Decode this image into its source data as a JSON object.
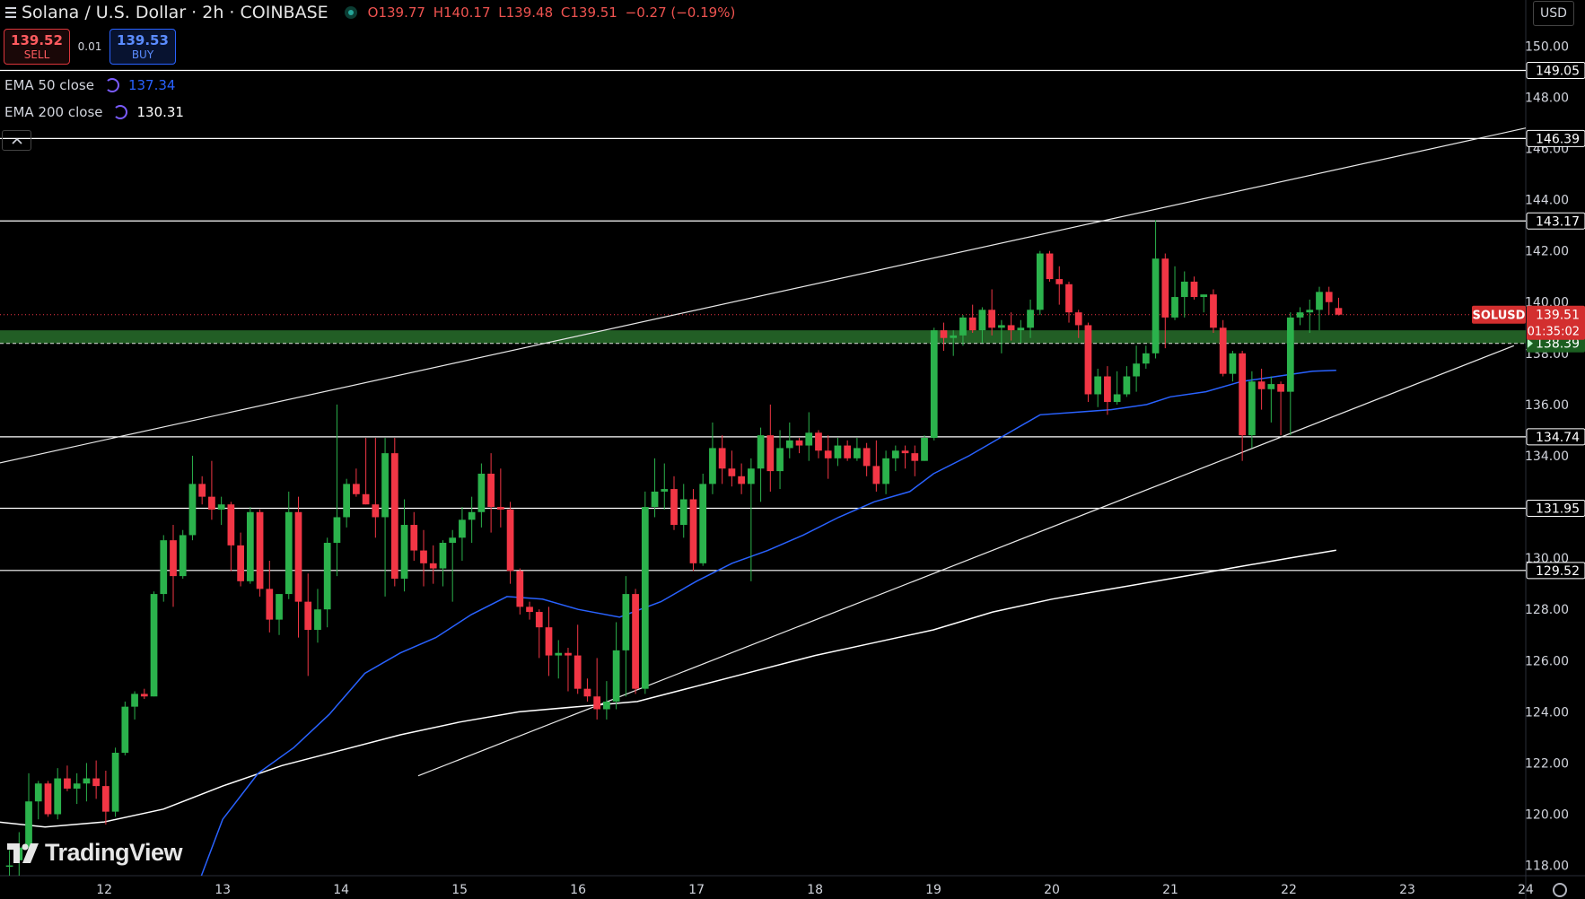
{
  "header": {
    "symbol": "Solana / U.S. Dollar · 2h · COINBASE",
    "open": "O139.77",
    "high": "H140.17",
    "low": "L139.48",
    "close": "C139.51",
    "change": "−0.27 (−0.19%)"
  },
  "trade": {
    "sell_price": "139.52",
    "sell_label": "SELL",
    "spread": "0.01",
    "buy_price": "139.53",
    "buy_label": "BUY"
  },
  "indicators": [
    {
      "label": "EMA 50 close",
      "value": "137.34",
      "color": "#2962ff"
    },
    {
      "label": "EMA 200 close",
      "value": "130.31",
      "color": "#ffffff"
    }
  ],
  "collapse_icon": "chevron-up-icon",
  "currency_button": "USD",
  "brand": "TradingView",
  "chart_data": {
    "type": "candlestick",
    "symbol": "SOLUSD",
    "timeframe": "2h",
    "x_ticks": [
      "12",
      "13",
      "14",
      "15",
      "16",
      "17",
      "18",
      "19",
      "20",
      "21",
      "22",
      "23",
      "24"
    ],
    "y_ticks": [
      "150.00",
      "148.00",
      "146.00",
      "144.00",
      "142.00",
      "140.00",
      "138.00",
      "136.00",
      "134.00",
      "132.00",
      "130.00",
      "128.00",
      "126.00",
      "124.00",
      "122.00",
      "120.00",
      "118.00"
    ],
    "ylim": [
      117.6,
      151.8
    ],
    "xlim": [
      11.12,
      24.0
    ],
    "colors": {
      "up": "#2bb24c",
      "down": "#f23645",
      "ema50": "#2962ff",
      "ema200": "#ffffff",
      "level": "#ffffff",
      "zone": "#2e7d32"
    },
    "horizontal_levels": [
      149.05,
      146.39,
      143.17,
      134.74,
      131.95,
      129.52
    ],
    "support_zone": [
      138.39,
      138.9
    ],
    "last_price": {
      "label": "SOLUSD",
      "value": "139.51",
      "countdown": "01:35:02",
      "price": 139.51
    },
    "zone_label": "138.39",
    "level_labels": [
      "149.05",
      "146.39",
      "143.17",
      "134.74",
      "131.95",
      "129.52"
    ],
    "trendlines": [
      {
        "name": "upper",
        "x": [
          11.0,
          24.0
        ],
        "y": [
          133.6,
          146.8
        ]
      },
      {
        "name": "lower",
        "x": [
          14.65,
          23.9
        ],
        "y": [
          121.5,
          138.3
        ]
      }
    ],
    "ema50": {
      "x": [
        12.82,
        13.0,
        13.3,
        13.6,
        13.9,
        14.2,
        14.5,
        14.8,
        15.1,
        15.4,
        15.7,
        16.0,
        16.35,
        16.7,
        17.0,
        17.3,
        17.6,
        17.9,
        18.2,
        18.5,
        18.8,
        19.0,
        19.3,
        19.6,
        19.9,
        20.2,
        20.5,
        20.8,
        21.0,
        21.3,
        21.6,
        21.9,
        22.2,
        22.4
      ],
      "y": [
        117.6,
        119.8,
        121.6,
        122.6,
        123.9,
        125.5,
        126.3,
        126.9,
        127.8,
        128.5,
        128.4,
        128.0,
        127.7,
        128.3,
        129.1,
        129.8,
        130.3,
        130.9,
        131.6,
        132.2,
        132.6,
        133.3,
        134.0,
        134.8,
        135.6,
        135.7,
        135.8,
        136.0,
        136.3,
        136.5,
        136.9,
        137.1,
        137.3,
        137.34
      ]
    },
    "ema200": {
      "x": [
        11.1,
        11.5,
        12.0,
        12.5,
        13.0,
        13.5,
        14.0,
        14.5,
        15.0,
        15.5,
        16.0,
        16.5,
        17.0,
        17.5,
        18.0,
        18.5,
        19.0,
        19.5,
        20.0,
        20.5,
        21.0,
        21.5,
        22.0,
        22.4
      ],
      "y": [
        119.7,
        119.5,
        119.7,
        120.2,
        121.1,
        121.9,
        122.5,
        123.1,
        123.6,
        124.0,
        124.2,
        124.4,
        125.0,
        125.6,
        126.2,
        126.7,
        127.2,
        127.9,
        128.4,
        128.8,
        129.2,
        129.6,
        130.0,
        130.31
      ]
    },
    "candles": [
      {
        "o": 118.0,
        "h": 118.6,
        "l": 117.6,
        "c": 118.0
      },
      {
        "o": 118.2,
        "h": 119.3,
        "l": 117.6,
        "c": 118.7
      },
      {
        "o": 118.7,
        "h": 121.6,
        "l": 118.3,
        "c": 120.5
      },
      {
        "o": 120.5,
        "h": 121.3,
        "l": 119.8,
        "c": 121.2
      },
      {
        "o": 121.2,
        "h": 121.3,
        "l": 119.9,
        "c": 120.0
      },
      {
        "o": 120.0,
        "h": 121.8,
        "l": 119.8,
        "c": 121.4
      },
      {
        "o": 121.4,
        "h": 121.9,
        "l": 120.9,
        "c": 121.0
      },
      {
        "o": 121.0,
        "h": 121.6,
        "l": 120.4,
        "c": 121.2
      },
      {
        "o": 121.2,
        "h": 122.0,
        "l": 120.5,
        "c": 121.4
      },
      {
        "o": 121.4,
        "h": 122.1,
        "l": 120.6,
        "c": 121.1
      },
      {
        "o": 121.1,
        "h": 121.7,
        "l": 119.6,
        "c": 120.1
      },
      {
        "o": 120.1,
        "h": 122.6,
        "l": 119.9,
        "c": 122.4
      },
      {
        "o": 122.4,
        "h": 124.4,
        "l": 122.3,
        "c": 124.2
      },
      {
        "o": 124.2,
        "h": 124.8,
        "l": 123.7,
        "c": 124.7
      },
      {
        "o": 124.7,
        "h": 124.9,
        "l": 124.5,
        "c": 124.6
      },
      {
        "o": 124.6,
        "h": 128.7,
        "l": 124.6,
        "c": 128.6
      },
      {
        "o": 128.6,
        "h": 130.9,
        "l": 128.3,
        "c": 130.7
      },
      {
        "o": 130.7,
        "h": 131.3,
        "l": 128.1,
        "c": 129.3
      },
      {
        "o": 129.3,
        "h": 131.1,
        "l": 129.2,
        "c": 130.9
      },
      {
        "o": 130.9,
        "h": 134.0,
        "l": 130.7,
        "c": 132.9
      },
      {
        "o": 132.9,
        "h": 133.2,
        "l": 132.1,
        "c": 132.4
      },
      {
        "o": 132.4,
        "h": 133.8,
        "l": 131.5,
        "c": 131.9
      },
      {
        "o": 131.9,
        "h": 132.4,
        "l": 131.3,
        "c": 132.1
      },
      {
        "o": 132.1,
        "h": 132.2,
        "l": 129.5,
        "c": 130.5
      },
      {
        "o": 130.5,
        "h": 131.0,
        "l": 128.9,
        "c": 129.1
      },
      {
        "o": 129.1,
        "h": 132.0,
        "l": 129.0,
        "c": 131.8
      },
      {
        "o": 131.8,
        "h": 131.9,
        "l": 128.5,
        "c": 128.8
      },
      {
        "o": 128.8,
        "h": 129.9,
        "l": 127.1,
        "c": 127.6
      },
      {
        "o": 127.6,
        "h": 128.6,
        "l": 127.0,
        "c": 128.6
      },
      {
        "o": 128.6,
        "h": 132.6,
        "l": 128.4,
        "c": 131.8
      },
      {
        "o": 131.8,
        "h": 132.4,
        "l": 126.9,
        "c": 128.3
      },
      {
        "o": 128.3,
        "h": 129.4,
        "l": 125.4,
        "c": 127.2
      },
      {
        "o": 127.2,
        "h": 128.8,
        "l": 126.7,
        "c": 128.0
      },
      {
        "o": 128.0,
        "h": 130.8,
        "l": 127.3,
        "c": 130.6
      },
      {
        "o": 130.6,
        "h": 136.0,
        "l": 129.3,
        "c": 131.6
      },
      {
        "o": 131.6,
        "h": 133.1,
        "l": 131.2,
        "c": 132.9
      },
      {
        "o": 132.9,
        "h": 133.5,
        "l": 132.4,
        "c": 132.5
      },
      {
        "o": 132.5,
        "h": 134.7,
        "l": 132.1,
        "c": 132.1
      },
      {
        "o": 132.1,
        "h": 134.7,
        "l": 130.8,
        "c": 131.6
      },
      {
        "o": 131.6,
        "h": 134.7,
        "l": 128.5,
        "c": 134.1
      },
      {
        "o": 134.1,
        "h": 134.7,
        "l": 128.9,
        "c": 129.2
      },
      {
        "o": 129.2,
        "h": 132.3,
        "l": 128.7,
        "c": 131.3
      },
      {
        "o": 131.3,
        "h": 131.8,
        "l": 129.9,
        "c": 130.3
      },
      {
        "o": 130.3,
        "h": 131.1,
        "l": 128.9,
        "c": 129.8
      },
      {
        "o": 129.8,
        "h": 130.5,
        "l": 129.0,
        "c": 129.6
      },
      {
        "o": 129.6,
        "h": 130.7,
        "l": 128.9,
        "c": 130.6
      },
      {
        "o": 130.6,
        "h": 131.1,
        "l": 128.3,
        "c": 130.8
      },
      {
        "o": 130.8,
        "h": 132.0,
        "l": 129.9,
        "c": 131.5
      },
      {
        "o": 131.5,
        "h": 132.4,
        "l": 130.6,
        "c": 131.8
      },
      {
        "o": 131.8,
        "h": 133.7,
        "l": 131.2,
        "c": 133.3
      },
      {
        "o": 133.3,
        "h": 134.1,
        "l": 131.0,
        "c": 132.0
      },
      {
        "o": 132.0,
        "h": 133.5,
        "l": 131.2,
        "c": 131.9
      },
      {
        "o": 131.9,
        "h": 132.2,
        "l": 129.0,
        "c": 129.5
      },
      {
        "o": 129.5,
        "h": 129.6,
        "l": 127.8,
        "c": 128.1
      },
      {
        "o": 128.1,
        "h": 128.3,
        "l": 127.6,
        "c": 127.9
      },
      {
        "o": 127.9,
        "h": 128.0,
        "l": 126.1,
        "c": 127.3
      },
      {
        "o": 127.3,
        "h": 128.1,
        "l": 125.4,
        "c": 126.2
      },
      {
        "o": 126.2,
        "h": 126.8,
        "l": 125.3,
        "c": 126.3
      },
      {
        "o": 126.3,
        "h": 126.5,
        "l": 124.8,
        "c": 126.2
      },
      {
        "o": 126.2,
        "h": 127.4,
        "l": 124.7,
        "c": 124.9
      },
      {
        "o": 124.9,
        "h": 125.3,
        "l": 124.4,
        "c": 124.6
      },
      {
        "o": 124.6,
        "h": 126.1,
        "l": 123.7,
        "c": 124.1
      },
      {
        "o": 124.1,
        "h": 125.2,
        "l": 123.7,
        "c": 124.4
      },
      {
        "o": 124.4,
        "h": 127.5,
        "l": 124.1,
        "c": 126.4
      },
      {
        "o": 126.4,
        "h": 129.3,
        "l": 124.6,
        "c": 128.6
      },
      {
        "o": 128.6,
        "h": 128.8,
        "l": 124.7,
        "c": 124.9
      },
      {
        "o": 124.9,
        "h": 132.6,
        "l": 124.7,
        "c": 132.0
      },
      {
        "o": 132.0,
        "h": 133.9,
        "l": 131.6,
        "c": 132.6
      },
      {
        "o": 132.6,
        "h": 133.7,
        "l": 131.9,
        "c": 132.7
      },
      {
        "o": 132.7,
        "h": 133.2,
        "l": 131.1,
        "c": 131.3
      },
      {
        "o": 131.3,
        "h": 132.9,
        "l": 130.8,
        "c": 132.3
      },
      {
        "o": 132.3,
        "h": 132.7,
        "l": 129.5,
        "c": 129.8
      },
      {
        "o": 129.8,
        "h": 133.3,
        "l": 129.7,
        "c": 132.9
      },
      {
        "o": 132.9,
        "h": 135.3,
        "l": 132.5,
        "c": 134.3
      },
      {
        "o": 134.3,
        "h": 134.8,
        "l": 132.9,
        "c": 133.5
      },
      {
        "o": 133.5,
        "h": 134.2,
        "l": 132.8,
        "c": 133.2
      },
      {
        "o": 133.2,
        "h": 133.7,
        "l": 132.5,
        "c": 132.9
      },
      {
        "o": 132.9,
        "h": 133.9,
        "l": 129.1,
        "c": 133.5
      },
      {
        "o": 133.5,
        "h": 135.1,
        "l": 132.2,
        "c": 134.8
      },
      {
        "o": 134.8,
        "h": 136.0,
        "l": 132.6,
        "c": 133.4
      },
      {
        "o": 133.4,
        "h": 135.0,
        "l": 132.7,
        "c": 134.3
      },
      {
        "o": 134.3,
        "h": 135.3,
        "l": 133.9,
        "c": 134.6
      },
      {
        "o": 134.6,
        "h": 134.7,
        "l": 134.1,
        "c": 134.4
      },
      {
        "o": 134.4,
        "h": 135.7,
        "l": 133.8,
        "c": 134.9
      },
      {
        "o": 134.9,
        "h": 135.0,
        "l": 133.9,
        "c": 134.2
      },
      {
        "o": 134.2,
        "h": 134.8,
        "l": 133.1,
        "c": 133.9
      },
      {
        "o": 133.9,
        "h": 134.7,
        "l": 133.6,
        "c": 134.4
      },
      {
        "o": 134.4,
        "h": 134.6,
        "l": 133.8,
        "c": 133.9
      },
      {
        "o": 133.9,
        "h": 134.7,
        "l": 133.8,
        "c": 134.3
      },
      {
        "o": 134.3,
        "h": 134.5,
        "l": 133.2,
        "c": 133.6
      },
      {
        "o": 133.6,
        "h": 134.6,
        "l": 132.6,
        "c": 132.9
      },
      {
        "o": 132.9,
        "h": 134.2,
        "l": 132.5,
        "c": 133.9
      },
      {
        "o": 133.9,
        "h": 134.4,
        "l": 133.4,
        "c": 134.2
      },
      {
        "o": 134.2,
        "h": 134.4,
        "l": 133.5,
        "c": 134.1
      },
      {
        "o": 134.1,
        "h": 134.4,
        "l": 133.2,
        "c": 133.8
      },
      {
        "o": 133.8,
        "h": 134.8,
        "l": 133.8,
        "c": 134.7
      },
      {
        "o": 134.7,
        "h": 139.0,
        "l": 134.6,
        "c": 138.9
      },
      {
        "o": 138.9,
        "h": 139.2,
        "l": 138.1,
        "c": 138.6
      },
      {
        "o": 138.6,
        "h": 138.9,
        "l": 137.9,
        "c": 138.7
      },
      {
        "o": 138.7,
        "h": 139.5,
        "l": 138.3,
        "c": 139.4
      },
      {
        "o": 139.4,
        "h": 139.9,
        "l": 138.8,
        "c": 138.9
      },
      {
        "o": 138.9,
        "h": 139.8,
        "l": 138.4,
        "c": 139.7
      },
      {
        "o": 139.7,
        "h": 140.5,
        "l": 138.7,
        "c": 139.0
      },
      {
        "o": 139.0,
        "h": 139.3,
        "l": 138.0,
        "c": 139.1
      },
      {
        "o": 139.1,
        "h": 139.6,
        "l": 138.5,
        "c": 138.9
      },
      {
        "o": 138.9,
        "h": 139.3,
        "l": 138.4,
        "c": 139.0
      },
      {
        "o": 139.0,
        "h": 140.1,
        "l": 138.6,
        "c": 139.7
      },
      {
        "o": 139.7,
        "h": 142.0,
        "l": 139.5,
        "c": 141.9
      },
      {
        "o": 141.9,
        "h": 142.0,
        "l": 140.8,
        "c": 140.9
      },
      {
        "o": 140.9,
        "h": 141.4,
        "l": 139.9,
        "c": 140.7
      },
      {
        "o": 140.7,
        "h": 140.8,
        "l": 139.2,
        "c": 139.6
      },
      {
        "o": 139.6,
        "h": 139.7,
        "l": 138.6,
        "c": 139.1
      },
      {
        "o": 139.1,
        "h": 139.2,
        "l": 136.1,
        "c": 136.4
      },
      {
        "o": 136.4,
        "h": 137.4,
        "l": 135.9,
        "c": 137.1
      },
      {
        "o": 137.1,
        "h": 137.5,
        "l": 135.6,
        "c": 136.1
      },
      {
        "o": 136.1,
        "h": 137.3,
        "l": 136.0,
        "c": 136.4
      },
      {
        "o": 136.4,
        "h": 137.5,
        "l": 136.3,
        "c": 137.1
      },
      {
        "o": 137.1,
        "h": 138.3,
        "l": 136.5,
        "c": 137.6
      },
      {
        "o": 137.6,
        "h": 138.3,
        "l": 137.4,
        "c": 138.0
      },
      {
        "o": 138.0,
        "h": 143.2,
        "l": 137.8,
        "c": 141.7
      },
      {
        "o": 141.7,
        "h": 141.9,
        "l": 138.2,
        "c": 139.4
      },
      {
        "o": 139.4,
        "h": 141.4,
        "l": 139.3,
        "c": 140.2
      },
      {
        "o": 140.2,
        "h": 141.2,
        "l": 139.4,
        "c": 140.8
      },
      {
        "o": 140.8,
        "h": 141.0,
        "l": 140.1,
        "c": 140.2
      },
      {
        "o": 140.2,
        "h": 140.3,
        "l": 139.6,
        "c": 140.3
      },
      {
        "o": 140.3,
        "h": 140.5,
        "l": 138.8,
        "c": 139.0
      },
      {
        "o": 139.0,
        "h": 139.3,
        "l": 137.1,
        "c": 137.2
      },
      {
        "o": 137.2,
        "h": 138.1,
        "l": 136.9,
        "c": 138.0
      },
      {
        "o": 138.0,
        "h": 138.1,
        "l": 133.8,
        "c": 134.8
      },
      {
        "o": 134.8,
        "h": 137.3,
        "l": 134.3,
        "c": 136.9
      },
      {
        "o": 136.9,
        "h": 137.4,
        "l": 135.8,
        "c": 136.6
      },
      {
        "o": 136.6,
        "h": 137.1,
        "l": 135.3,
        "c": 136.8
      },
      {
        "o": 136.8,
        "h": 136.9,
        "l": 134.8,
        "c": 136.5
      },
      {
        "o": 136.5,
        "h": 139.6,
        "l": 134.8,
        "c": 139.4
      },
      {
        "o": 139.4,
        "h": 139.8,
        "l": 139.1,
        "c": 139.6
      },
      {
        "o": 139.6,
        "h": 140.1,
        "l": 138.8,
        "c": 139.7
      },
      {
        "o": 139.7,
        "h": 140.6,
        "l": 138.9,
        "c": 140.4
      },
      {
        "o": 140.4,
        "h": 140.6,
        "l": 139.5,
        "c": 140.0
      },
      {
        "o": 139.77,
        "h": 140.17,
        "l": 139.48,
        "c": 139.51
      }
    ]
  }
}
